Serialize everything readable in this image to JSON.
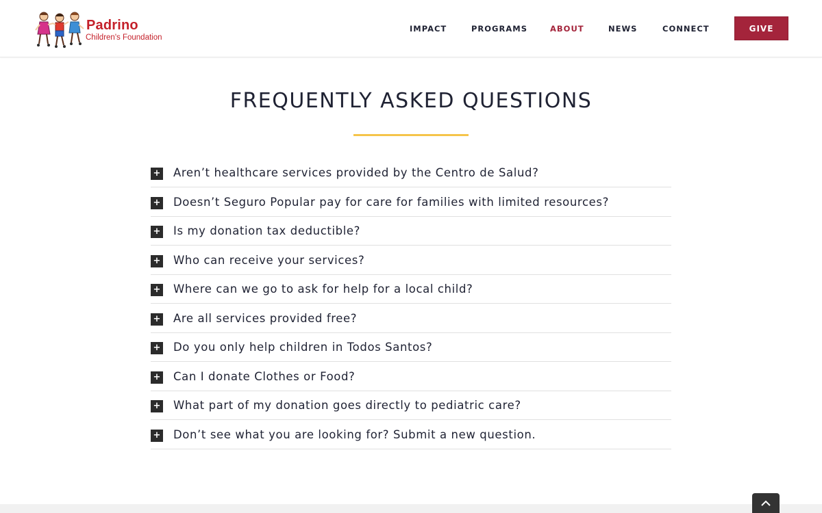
{
  "brand": {
    "name": "Padrino",
    "tagline": "Children's Foundation"
  },
  "nav": {
    "items": [
      {
        "label": "IMPACT",
        "active": false
      },
      {
        "label": "PROGRAMS",
        "active": false
      },
      {
        "label": "ABOUT",
        "active": true
      },
      {
        "label": "NEWS",
        "active": false
      },
      {
        "label": "CONNECT",
        "active": false
      }
    ],
    "give_label": "GIVE"
  },
  "faq": {
    "title": "FREQUENTLY ASKED QUESTIONS",
    "toggle_symbol": "+",
    "questions": [
      "Aren’t healthcare services provided by the Centro de Salud?",
      "Doesn’t Seguro Popular pay for care for families with limited resources?",
      "Is my donation tax deductible?",
      "Who can receive your services?",
      "Where can we go to ask for help for a local child?",
      "Are all services provided free?",
      "Do you only help children in Todos Santos?",
      "Can I donate Clothes or Food?",
      "What part of my donation goes directly to pediatric care?",
      "Don’t see what you are looking for? Submit a new question."
    ]
  },
  "colors": {
    "brand_red": "#c4202a",
    "give_button": "#a4243b",
    "active_nav": "#a4243b",
    "title_rule": "#f5c44a",
    "text_dark": "#1f2233"
  },
  "icons": {
    "faq_toggle": "plus-icon",
    "scroll_top": "chevron-up-icon"
  }
}
